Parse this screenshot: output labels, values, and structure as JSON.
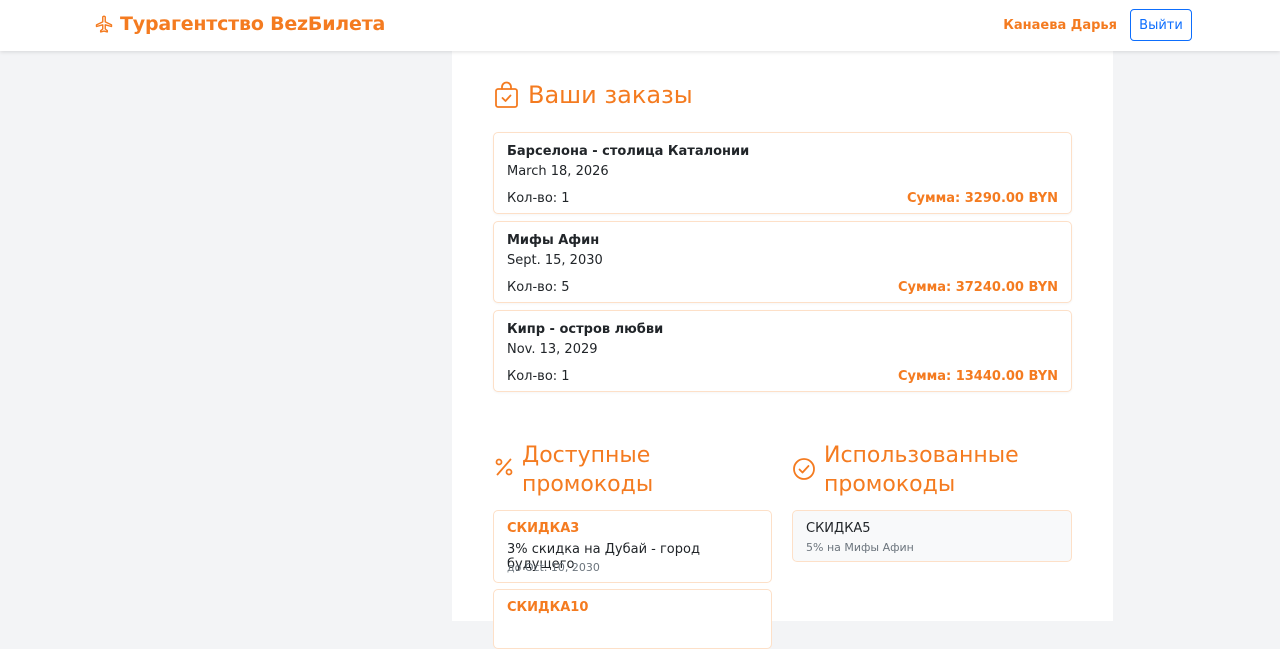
{
  "navbar": {
    "brand": "Турагентство BezБилета",
    "brand_icon": "airplane-icon",
    "user_name": "Канаева Дарья",
    "logout_label": "Выйти"
  },
  "orders": {
    "heading": "Ваши заказы",
    "heading_icon": "shopping-bag-check-icon",
    "items": [
      {
        "title": "Барселона - столица Каталонии",
        "date": "March 18, 2026",
        "qty": "Кол-во: 1",
        "sum": "Сумма: 3290.00 BYN"
      },
      {
        "title": "Мифы Афин",
        "date": "Sept. 15, 2030",
        "qty": "Кол-во: 5",
        "sum": "Сумма: 37240.00 BYN"
      },
      {
        "title": "Кипр - остров любви",
        "date": "Nov. 13, 2029",
        "qty": "Кол-во: 1",
        "sum": "Сумма: 13440.00 BYN"
      }
    ]
  },
  "available_promos": {
    "heading_line1": "Доступные",
    "heading_line2": "промокоды",
    "heading_icon": "percent-icon",
    "items": [
      {
        "code": "СКИДКА3",
        "desc": "3% скидка на Дубай - город будущего",
        "until": "до Oct. 10, 2030"
      },
      {
        "code": "СКИДКА10"
      }
    ]
  },
  "used_promos": {
    "heading_line1": "Использованные",
    "heading_line2": "промокоды",
    "heading_icon": "check-circle-icon",
    "items": [
      {
        "code": "СКИДКА5",
        "desc": "5% на Мифы Афин"
      }
    ]
  },
  "colors": {
    "accent": "#f47b20",
    "outline_button": "#0d6efd",
    "page_bg": "#f3f4f6"
  }
}
